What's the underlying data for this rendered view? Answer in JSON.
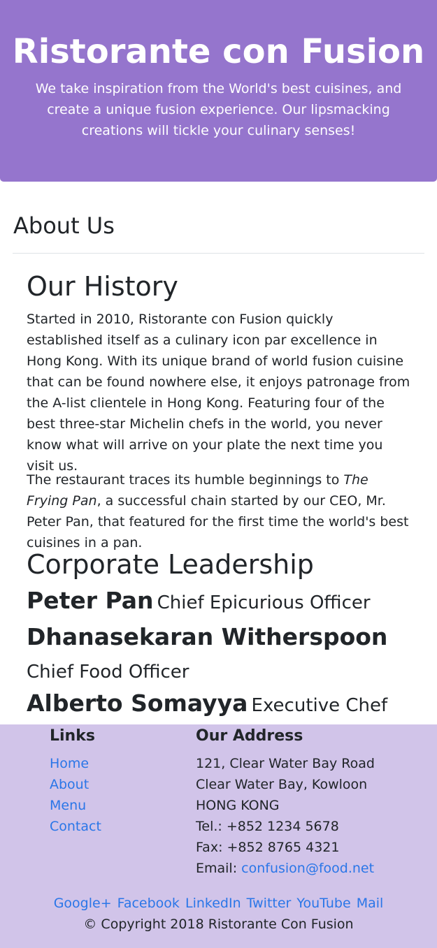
{
  "header": {
    "title": "Ristorante con Fusion",
    "tagline": "We take inspiration from the World's best cuisines, and create a unique fusion experience. Our lipsmacking creations will tickle your culinary senses!"
  },
  "about": {
    "title": "About Us"
  },
  "history": {
    "title": "Our History",
    "paragraph1": "Started in 2010, Ristorante con Fusion quickly established itself as a culinary icon par excellence in Hong Kong. With its unique brand of world fusion cuisine that can be found nowhere else, it enjoys patronage from the A-list clientele in Hong Kong. Featuring four of the best three-star Michelin chefs in the world, you never know what will arrive on your plate the next time you visit us.",
    "paragraph2_before": "The restaurant traces its humble beginnings to ",
    "paragraph2_em": "The Frying Pan",
    "paragraph2_after": ", a successful chain started by our CEO, Mr. Peter Pan, that featured for the first time the world's best cuisines in a pan."
  },
  "leadership": {
    "title": "Corporate Leadership",
    "leaders": [
      {
        "name": "Peter Pan",
        "role": "Chief Epicurious Officer"
      },
      {
        "name": "Dhanasekaran Witherspoon",
        "role": "Chief Food Officer"
      },
      {
        "name": "Alberto Somayya",
        "role": "Executive Chef"
      }
    ]
  },
  "footer": {
    "links_title": "Links",
    "links": [
      "Home",
      "About",
      "Menu",
      "Contact"
    ],
    "address_title": "Our Address",
    "address_lines": [
      "121, Clear Water Bay Road",
      "Clear Water Bay, Kowloon",
      "HONG KONG",
      "Tel.: +852 1234 5678",
      "Fax: +852 8765 4321"
    ],
    "email_label": "Email: ",
    "email": "confusion@food.net",
    "social": [
      "Google+",
      "Facebook",
      "LinkedIn",
      "Twitter",
      "YouTube",
      "Mail"
    ],
    "copyright": "© Copyright 2018 Ristorante Con Fusion"
  },
  "colors": {
    "header_bg": "#9575cd",
    "footer_bg": "#d1c4e9",
    "link": "#2a76e8"
  }
}
